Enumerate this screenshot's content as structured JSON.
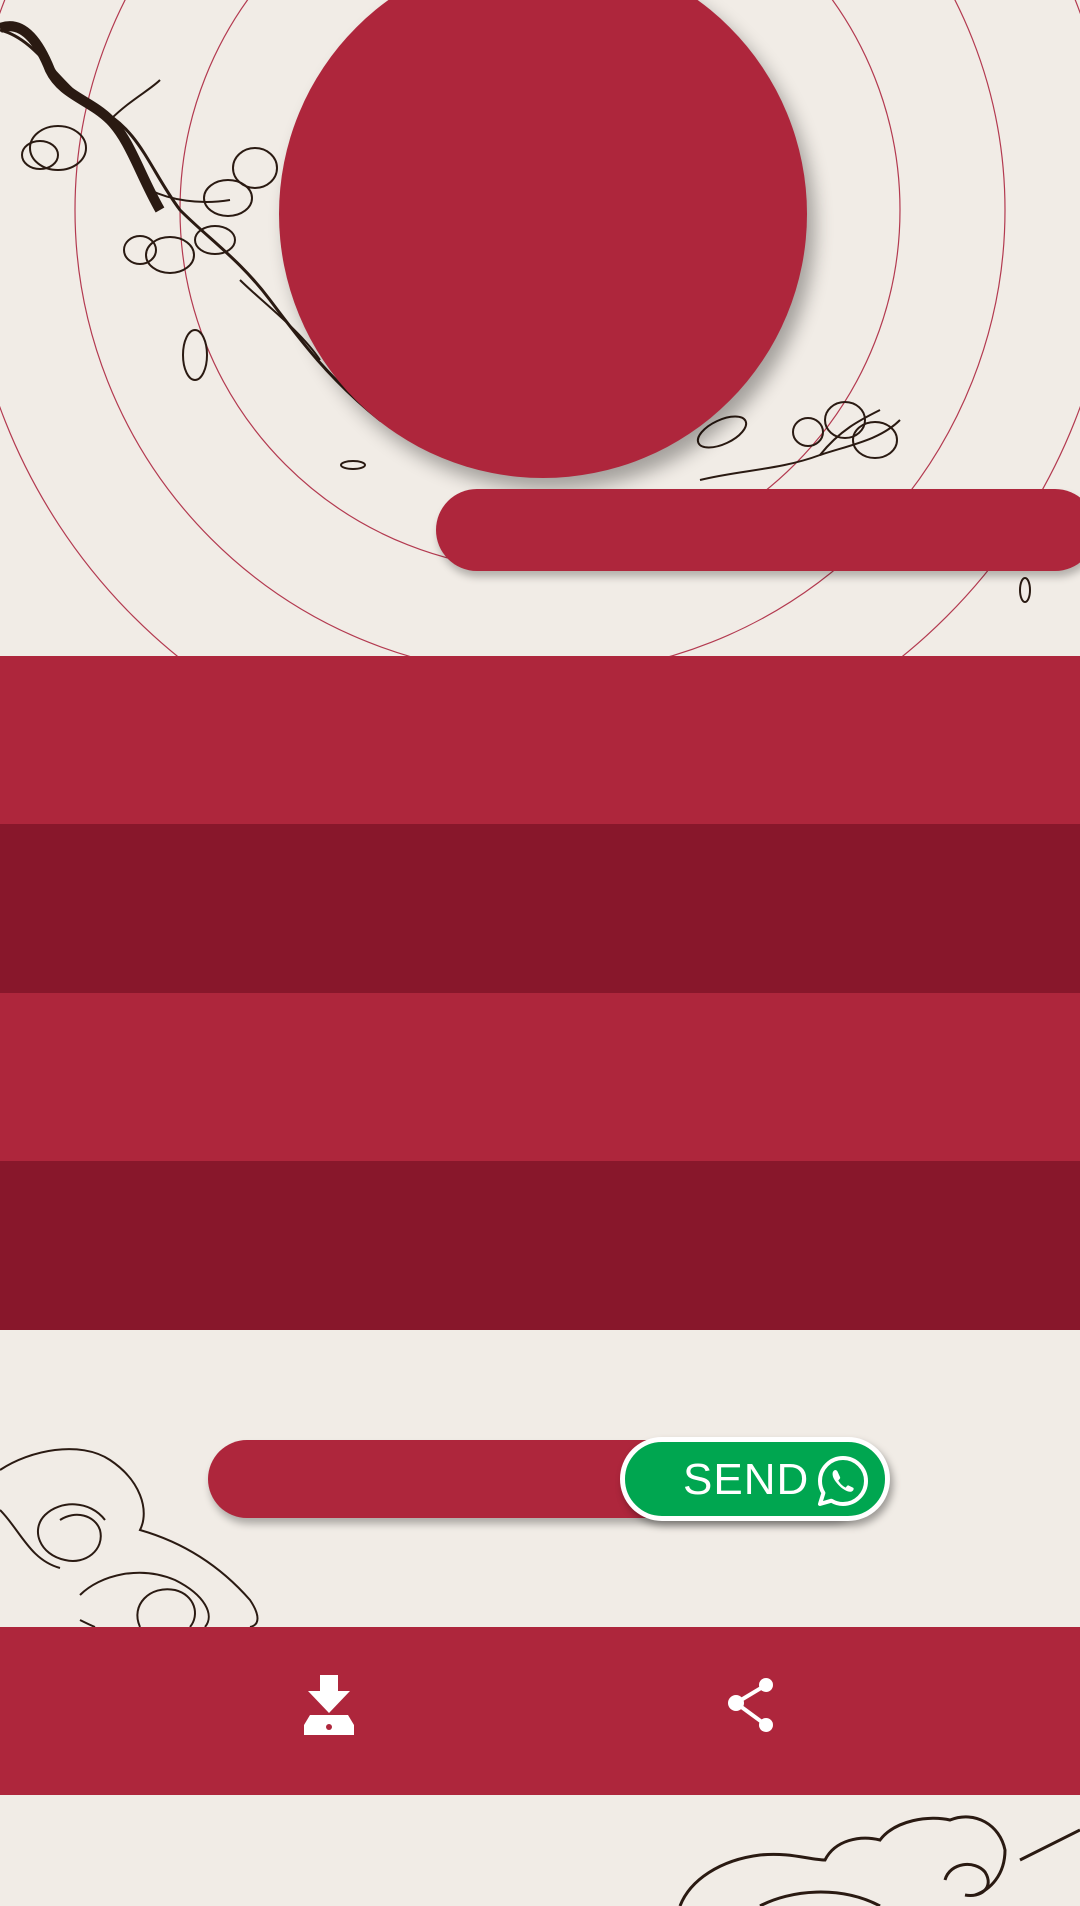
{
  "colors": {
    "background": "#F1ECE6",
    "primary_red": "#AE263C",
    "dark_red": "#88172B",
    "whatsapp_green": "#00A650",
    "line_art": "#2A1A12"
  },
  "send_button": {
    "label": "SEND",
    "icon": "whatsapp-icon"
  },
  "bottom_bar": {
    "download_icon": "download-icon",
    "share_icon": "share-icon"
  }
}
